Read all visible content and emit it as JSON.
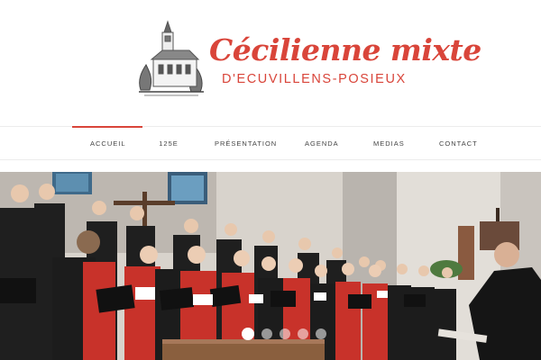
{
  "brand": {
    "title": "Cécilienne mixte",
    "subtitle": "D'ECUVILLENS-POSIEUX",
    "accent_color": "#d9453a",
    "logo_icon": "church-sketch-icon"
  },
  "nav": {
    "items": [
      {
        "label": "ACCUEIL",
        "active": true
      },
      {
        "label": "125E",
        "active": false
      },
      {
        "label": "PRÉSENTATION",
        "active": false
      },
      {
        "label": "AGENDA",
        "active": false
      },
      {
        "label": "MEDIAS",
        "active": false
      },
      {
        "label": "CONTACT",
        "active": false
      }
    ]
  },
  "slider": {
    "image": "choir-performing-in-church-photo",
    "slide_count": 5,
    "active_slide": 1
  }
}
